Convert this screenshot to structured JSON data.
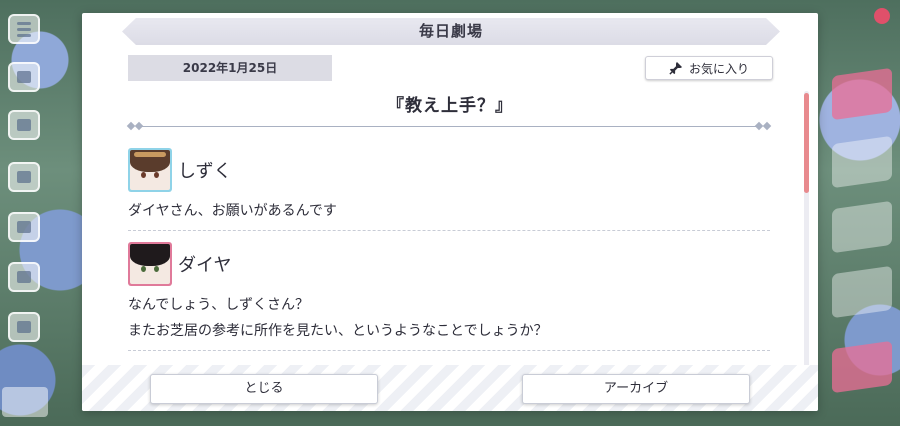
{
  "dialog": {
    "title": "毎日劇場",
    "date": "2022年1月25日",
    "favorite_label": "お気に入り",
    "story_title": "『教え上手？』"
  },
  "entries": [
    {
      "speaker": "しずく",
      "avatar_color": "#8fd3e8",
      "lines": [
        "ダイヤさん、お願いがあるんです"
      ]
    },
    {
      "speaker": "ダイヤ",
      "avatar_color": "#e07a9a",
      "lines": [
        "なんでしょう、しずくさん？",
        "またお芝居の参考に所作を見たい、というようなことでしょうか？"
      ]
    }
  ],
  "buttons": {
    "close_label": "とじる",
    "archive_label": "アーカイブ"
  },
  "icons": {
    "favorite": "pushpin-icon"
  },
  "colors": {
    "scroll_thumb": "#e88a8e",
    "title_bar": "#dcdce6"
  }
}
